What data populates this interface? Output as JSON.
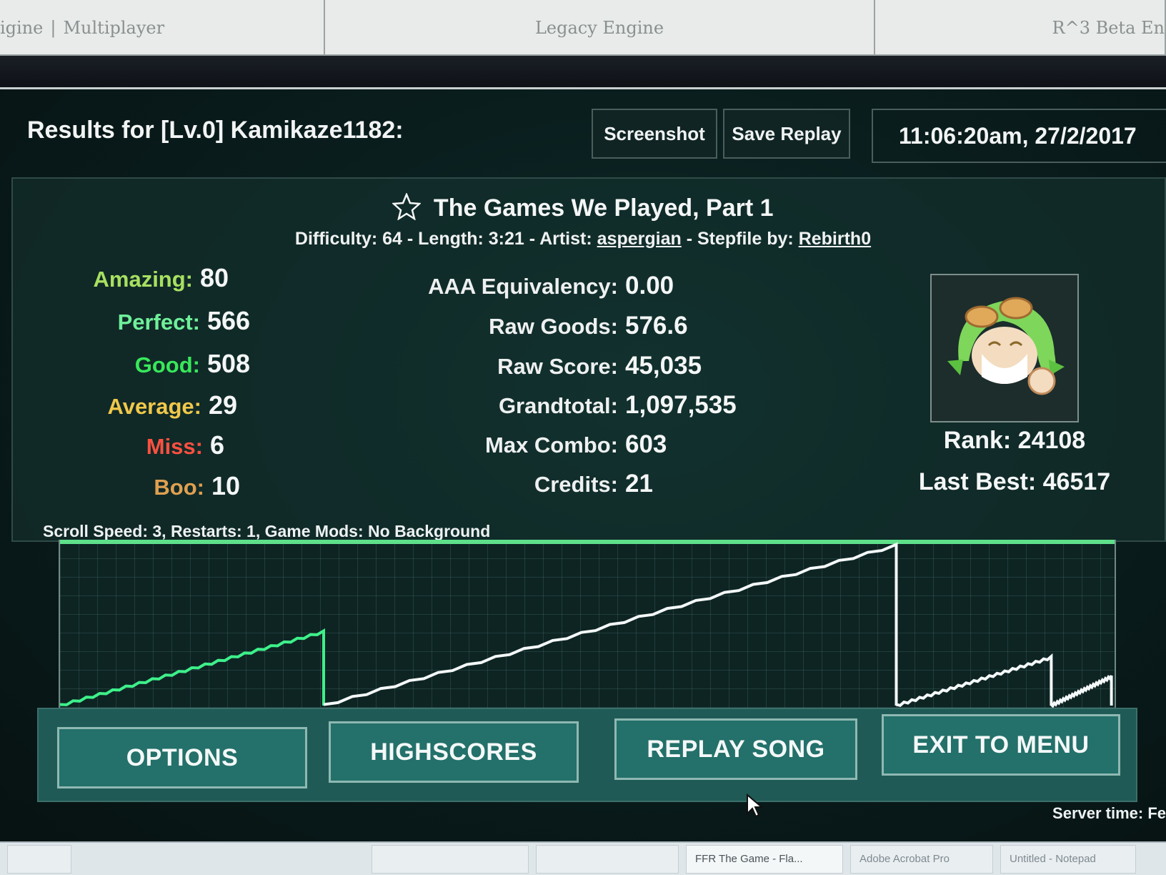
{
  "browser": {
    "tabs": [
      {
        "left": "igine",
        "right": "Multiplayer"
      },
      {
        "label": "Legacy Engine"
      },
      {
        "label": "R^3 Beta En"
      }
    ],
    "tab_separator": "|"
  },
  "header": {
    "results_title": "Results for [Lv.0] Kamikaze1182:",
    "screenshot_label": "Screenshot",
    "save_replay_label": "Save Replay",
    "datetime": "11:06:20am, 27/2/2017"
  },
  "song": {
    "title": "The Games We Played, Part 1",
    "difficulty_text": "Difficulty: 64 - Length: 3:21 -",
    "artist_label": "Artist:",
    "artist": "aspergian",
    "dash": "-",
    "stepfile_label": "Stepfile by:",
    "stepfile_by": "Rebirth0"
  },
  "judgements": [
    {
      "label": "Amazing:",
      "value": "80",
      "color": "#a8e060"
    },
    {
      "label": "Perfect:",
      "value": "566",
      "color": "#6ff09a"
    },
    {
      "label": "Good:",
      "value": "508",
      "color": "#38e85a"
    },
    {
      "label": "Average:",
      "value": "29",
      "color": "#f0c84a"
    },
    {
      "label": "Miss:",
      "value": "6",
      "color": "#ff5040"
    },
    {
      "label": "Boo:",
      "value": "10",
      "color": "#e0a050"
    }
  ],
  "scores": [
    {
      "label": "AAA Equivalency:",
      "value": "0.00"
    },
    {
      "label": "Raw Goods:",
      "value": "576.6"
    },
    {
      "label": "Raw Score:",
      "value": "45,035"
    },
    {
      "label": "Grandtotal:",
      "value": "1,097,535"
    },
    {
      "label": "Max Combo:",
      "value": "603"
    },
    {
      "label": "Credits:",
      "value": "21"
    }
  ],
  "player": {
    "rank": "Rank: 24108",
    "last_best": "Last Best: 46517",
    "avatar_icon": "avatar-icon"
  },
  "scroll_info": "Scroll Speed: 3, Restarts: 1, Game Mods: No Background",
  "combo_graph": {
    "segments": [
      {
        "start": 0.0,
        "end": 0.25,
        "peak": 0.46,
        "color": "#3ef08a"
      },
      {
        "start": 0.25,
        "end": 0.793,
        "peak": 1.0,
        "color": "#f4f8f8"
      },
      {
        "start": 0.793,
        "end": 0.94,
        "peak": 0.3,
        "color": "#f4f8f8"
      },
      {
        "start": 0.94,
        "end": 0.997,
        "peak": 0.18,
        "color": "#f4f8f8"
      }
    ]
  },
  "buttons": {
    "options": "OPTIONS",
    "highscores": "HIGHSCORES",
    "replay_song": "REPLAY SONG",
    "exit_to_menu": "EXIT TO MENU"
  },
  "server_time": "Server time: Fe",
  "taskbar": {
    "items": [
      "",
      "",
      "",
      "FFR The Game - Fla...",
      "Adobe Acrobat Pro",
      "Untitled - Notepad"
    ]
  }
}
